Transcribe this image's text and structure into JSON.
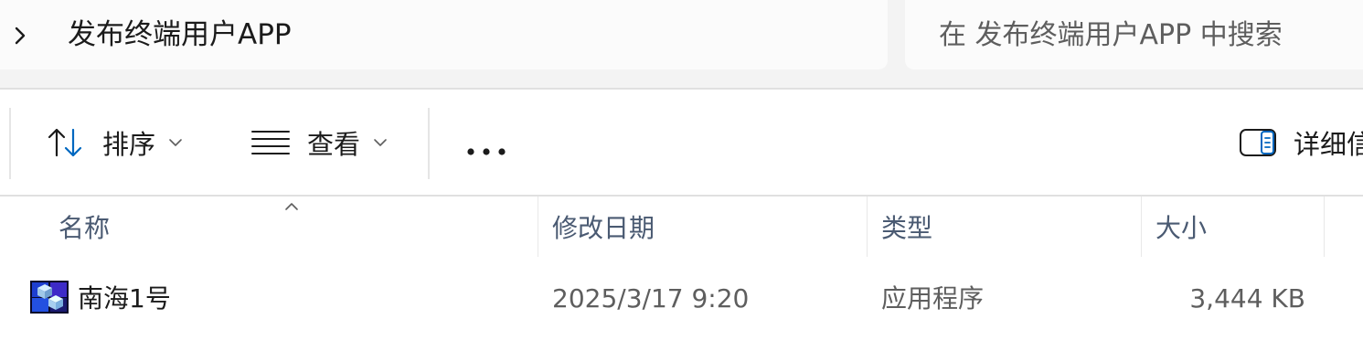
{
  "address_bar": {
    "breadcrumb": [
      "发布终端用户APP"
    ],
    "search_placeholder": "在 发布终端用户APP 中搜索"
  },
  "toolbar": {
    "sort_label": "排序",
    "view_label": "查看",
    "details_label": "详细信",
    "icons": [
      "sort-arrows-icon",
      "list-view-icon",
      "more-icon",
      "details-pane-icon"
    ]
  },
  "columns": {
    "name": "名称",
    "modified": "修改日期",
    "type": "类型",
    "size": "大小",
    "sorted_by": "name",
    "sort_direction": "ascending"
  },
  "files": [
    {
      "name": "南海1号",
      "modified": "2025/3/17 9:20",
      "type": "应用程序",
      "size": "3,444 KB",
      "icon": "application-icon"
    }
  ],
  "colors": {
    "accent": "#0067c0",
    "header_text": "#4a5a72",
    "secondary_text": "#5e5e5e"
  }
}
